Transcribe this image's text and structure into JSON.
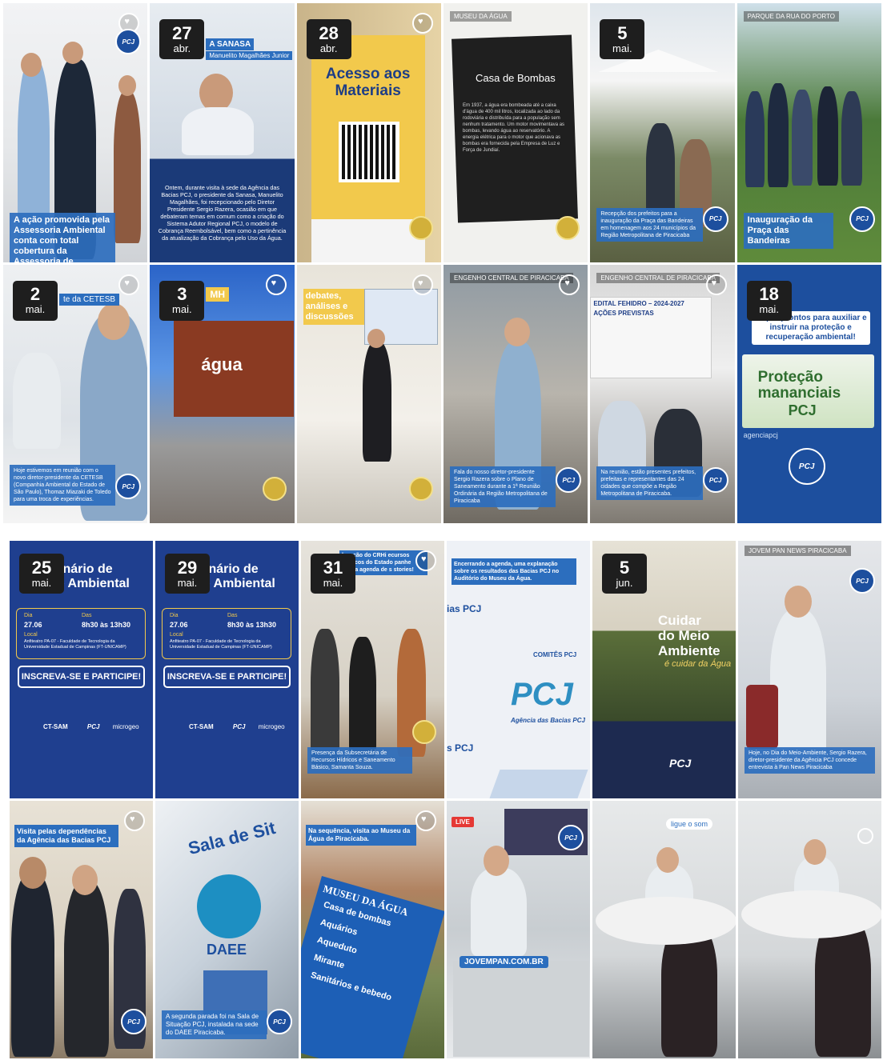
{
  "top": {
    "tiles": [
      {
        "date_day": "",
        "date_month": "",
        "caption": "A ação promovida pela Assessoria Ambiental conta com total cobertura da Assessoria de Comunicação"
      },
      {
        "date_day": "27",
        "date_month": "abr.",
        "title": "A SANASA",
        "subtitle": "Manuelito Magalhães Junior",
        "caption": "Ontem, durante visita à sede da Agência das Bacias PCJ, o presidente da Sanasa, Manuelito Magalhães, foi recepcionado pelo Diretor Presidente Sergio Razera, ocasião em que debateram temas em comum como a criação do Sistema Adutor Regional PCJ, o modelo de Cobrança Reembolsável, bem como a pertinência da atualização da Cobrança pelo Uso da Água."
      },
      {
        "date_day": "28",
        "date_month": "abr.",
        "banner": "Acesso aos Materiais"
      },
      {
        "location": "MUSEU DA ÁGUA",
        "plaque_title": "Casa de Bombas",
        "plaque_text": "Em 1937, a água era bombeada até a caixa d'água de 400 mil litros, localizada ao lado da rodoviária e distribuída para a população sem nenhum tratamento. Um motor movimentava as bombas, levando água ao reservatório. A energia elétrica para o motor que acionava as bombas era fornecida pela Empresa de Luz e Força de Jundiaí."
      },
      {
        "date_day": "5",
        "date_month": "mai.",
        "caption": "Recepção dos prefeitos para a inauguração da Praça das Bandeiras em homenagem aos 24 municípios da Região Metropolitana de Piracicaba"
      },
      {
        "location": "PARQUE DA RUA DO PORTO",
        "caption": "Inauguração da Praça das Bandeiras"
      },
      {
        "date_day": "2",
        "date_month": "mai.",
        "title": "te da CETESB",
        "caption": "Hoje estivemos em reunião com o novo diretor-presidente da CETESB (Companhia Ambiental do Estado de São Paulo), Thomaz Miazaki de Toledo para uma troca de experiências."
      },
      {
        "date_day": "3",
        "date_month": "mai.",
        "title": "MH",
        "wall": "água"
      },
      {
        "caption_top": "debates, análises e discussões"
      },
      {
        "location": "ENGENHO CENTRAL DE PIRACICABA",
        "caption": "Fala do nosso diretor-presidente Sergio Razera sobre o Plano de Saneamento durante a 1ª Reunião Ordinária da Região Metropolitana de Piracicaba"
      },
      {
        "location": "ENGENHO CENTRAL DE PIRACICABA",
        "screen_title": "EDITAL FEHIDRO – 2024-2027",
        "screen_sub": "AÇÕES PREVISTAS",
        "caption": "Na reunião, estão presentes prefeitos, prefeitas e representantes das 24 cidades que compõe a Região Metropolitana de Piracicaba."
      },
      {
        "date_day": "18",
        "date_month": "mai.",
        "top_text": "empre prontos para auxiliar e instruir na proteção e recuperação ambiental!",
        "card_line1": "Proteção",
        "card_line2": "mananciais",
        "card_line3": "PCJ",
        "card_tag": "agenciapcj"
      }
    ]
  },
  "bottom": {
    "tiles": [
      {
        "date_day": "25",
        "date_month": "mai.",
        "title_l1": "inário de",
        "title_l2": "de Ambiental",
        "dia_label": "Dia",
        "dia": "27.06",
        "das_label": "Das",
        "das": "8h30 às 13h30",
        "local_label": "Local",
        "local": "Anfiteatro PA-07 - Faculdade de Tecnologia da Universidade Estadual de Campinas (FT-UNICAMP)",
        "cta": "INSCREVA-SE E PARTICIPE!",
        "sponsor1": "CT-SAM",
        "sponsor2": "PCJ",
        "sponsor3": "microgeo"
      },
      {
        "date_day": "29",
        "date_month": "mai.",
        "title_l1": "inário de",
        "title_l2": "de Ambiental",
        "dia_label": "Dia",
        "dia": "27.06",
        "das_label": "Das",
        "das": "8h30 às 13h30",
        "local_label": "Local",
        "local": "Anfiteatro PA-07 - Faculdade de Tecnologia da Universidade Estadual de Campinas (FT-UNICAMP)",
        "cta": "INSCREVA-SE E PARTICIPE!",
        "sponsor1": "CT-SAM",
        "sponsor2": "PCJ",
        "sponsor3": "microgeo"
      },
      {
        "date_day": "31",
        "date_month": "mai.",
        "caption_top": "legação do CRHi ecursos Hídricos do Estado panhe nossa agenda de s stories!",
        "caption": "Presença da Subsecretária de Recursos Hídricos e Saneamento Básico, Samanta Souza."
      },
      {
        "caption_top": "Encerrando a agenda, uma explanação sobre os resultados das Bacias PCJ no Auditório do Museu da Água.",
        "wall1": "ias PCJ",
        "wall2": "COMITÊS PCJ",
        "wall3": "PCJ",
        "wall4": "Agência das Bacias PCJ",
        "wall5": "s PCJ"
      },
      {
        "date_day": "5",
        "date_month": "jun.",
        "title_l1": "Cuidar",
        "title_l2": "do Meio",
        "title_l3": "Ambiente",
        "title_l4": "é cuidar da Água",
        "footer": "PCJ"
      },
      {
        "location": "JOVEM PAN NEWS PIRACICABA",
        "caption": "Hoje, no Dia do Meio-Ambiente, Sergio Razera, diretor-presidente da Agência PCJ concede entrevista à Pan News Piracicaba"
      },
      {
        "caption_top": "Visita pelas dependências da Agência das Bacias PCJ"
      },
      {
        "wall": "Sala de Sit",
        "logo": "DAEE",
        "caption": "A segunda parada foi na Sala de Situação PCJ, instalada na sede do DAEE Piracicaba."
      },
      {
        "caption_top": "Na sequência, visita ao Museu da Água de Piracicaba.",
        "sign_title": "MUSEU DA ÁGUA",
        "sign_items": [
          "Casa de bombas",
          "Aquários",
          "Aqueduto",
          "Mirante",
          "Sanitários e bebedo"
        ]
      },
      {
        "live": "LIVE",
        "url": "JOVEMPAN.COM.BR"
      },
      {
        "sticker": "ligue o som"
      },
      {}
    ]
  }
}
